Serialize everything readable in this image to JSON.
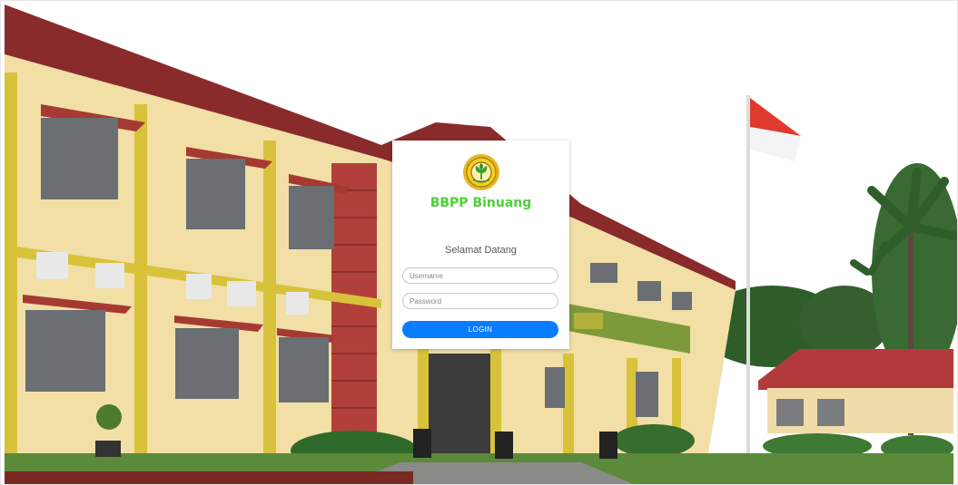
{
  "login": {
    "brand_name": "BBPP Binuang",
    "welcome_text": "Selamat Datang",
    "username_placeholder": "Username",
    "password_placeholder": "Password",
    "login_label": "LOGIN"
  },
  "colors": {
    "brand_green": "#4cd137",
    "login_button": "#0a7cff",
    "card_background": "#ffffff"
  },
  "icons": {
    "logo": "bbpp-emblem-icon"
  }
}
